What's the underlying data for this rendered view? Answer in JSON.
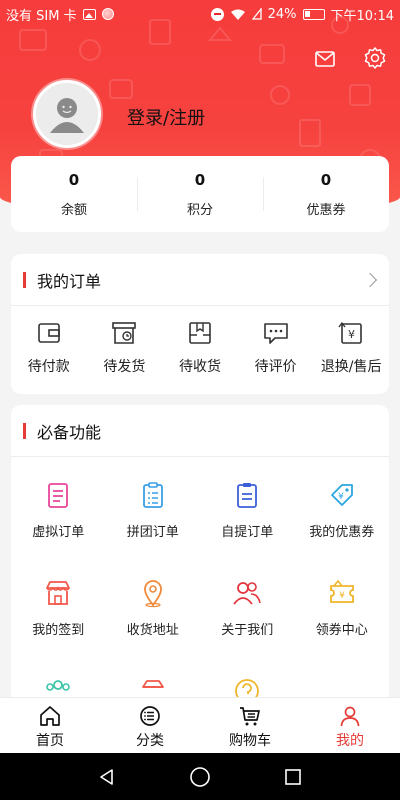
{
  "status_bar": {
    "carrier": "没有 SIM 卡",
    "battery": "24%",
    "time": "下午10:14"
  },
  "header": {
    "login_label": "登录/注册"
  },
  "stats": [
    {
      "value": "0",
      "label": "余额"
    },
    {
      "value": "0",
      "label": "积分"
    },
    {
      "value": "0",
      "label": "优惠券"
    }
  ],
  "orders": {
    "title": "我的订单",
    "items": [
      {
        "label": "待付款",
        "icon": "wallet-icon"
      },
      {
        "label": "待发货",
        "icon": "box-clock-icon"
      },
      {
        "label": "待收货",
        "icon": "package-icon"
      },
      {
        "label": "待评价",
        "icon": "comment-icon"
      },
      {
        "label": "退换/售后",
        "icon": "refund-icon"
      }
    ]
  },
  "features": {
    "title": "必备功能",
    "items": [
      {
        "label": "虚拟订单",
        "icon": "virtual-order-icon",
        "color": "#e8459a"
      },
      {
        "label": "拼团订单",
        "icon": "group-order-icon",
        "color": "#3a9ee8"
      },
      {
        "label": "自提订单",
        "icon": "pickup-order-icon",
        "color": "#3b5fd9"
      },
      {
        "label": "我的优惠券",
        "icon": "coupon-tag-icon",
        "color": "#2aa6e0"
      },
      {
        "label": "我的签到",
        "icon": "store-icon",
        "color": "#f2584a"
      },
      {
        "label": "收货地址",
        "icon": "location-icon",
        "color": "#f08a3a"
      },
      {
        "label": "关于我们",
        "icon": "people-icon",
        "color": "#e4353e"
      },
      {
        "label": "领券中心",
        "icon": "coupon-wallet-icon",
        "color": "#f0b52a"
      }
    ],
    "partial_icons": [
      {
        "icon": "team-icon",
        "color": "#3dc4a8"
      },
      {
        "icon": "basket-icon",
        "color": "#f2584a"
      },
      {
        "icon": "help-icon",
        "color": "#f0b52a"
      }
    ]
  },
  "tabbar": [
    {
      "label": "首页",
      "icon": "home-icon",
      "active": false
    },
    {
      "label": "分类",
      "icon": "category-icon",
      "active": false
    },
    {
      "label": "购物车",
      "icon": "cart-icon",
      "active": false
    },
    {
      "label": "我的",
      "icon": "user-icon",
      "active": true
    }
  ],
  "colors": {
    "brand": "#f63c3c",
    "accent": "#e63a36",
    "active_tab": "#e63a36"
  }
}
